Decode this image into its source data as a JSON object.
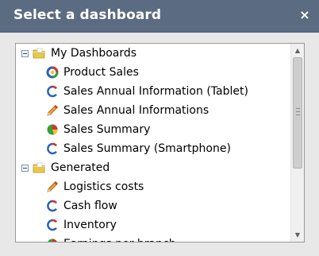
{
  "dialog": {
    "title": "Select a dashboard",
    "close_glyph": "×"
  },
  "tree": [
    {
      "label": "My Dashboards",
      "icon": "folder-icon",
      "children": [
        {
          "label": "Product Sales",
          "icon": "donut-chart-icon"
        },
        {
          "label": "Sales Annual Information (Tablet)",
          "icon": "ring-chart-icon"
        },
        {
          "label": "Sales Annual Informations",
          "icon": "pencil-chart-icon"
        },
        {
          "label": "Sales Summary",
          "icon": "pie-chart-icon"
        },
        {
          "label": "Sales Summary (Smartphone)",
          "icon": "ring-chart-icon"
        }
      ]
    },
    {
      "label": "Generated",
      "icon": "folder-icon",
      "children": [
        {
          "label": "Logistics costs",
          "icon": "pencil-chart-icon"
        },
        {
          "label": "Cash flow",
          "icon": "ring-chart-icon"
        },
        {
          "label": "Inventory",
          "icon": "ring-chart-icon"
        },
        {
          "label": "Earnings per branch",
          "icon": "pie-chart-icon"
        }
      ]
    }
  ],
  "colors": {
    "titlebar": "#5b6b82",
    "folder": "#e8c84a",
    "chart_blue": "#2c5fb4",
    "chart_red": "#d6342a",
    "chart_green": "#3a9d3a",
    "chart_yellow": "#f1c232"
  }
}
